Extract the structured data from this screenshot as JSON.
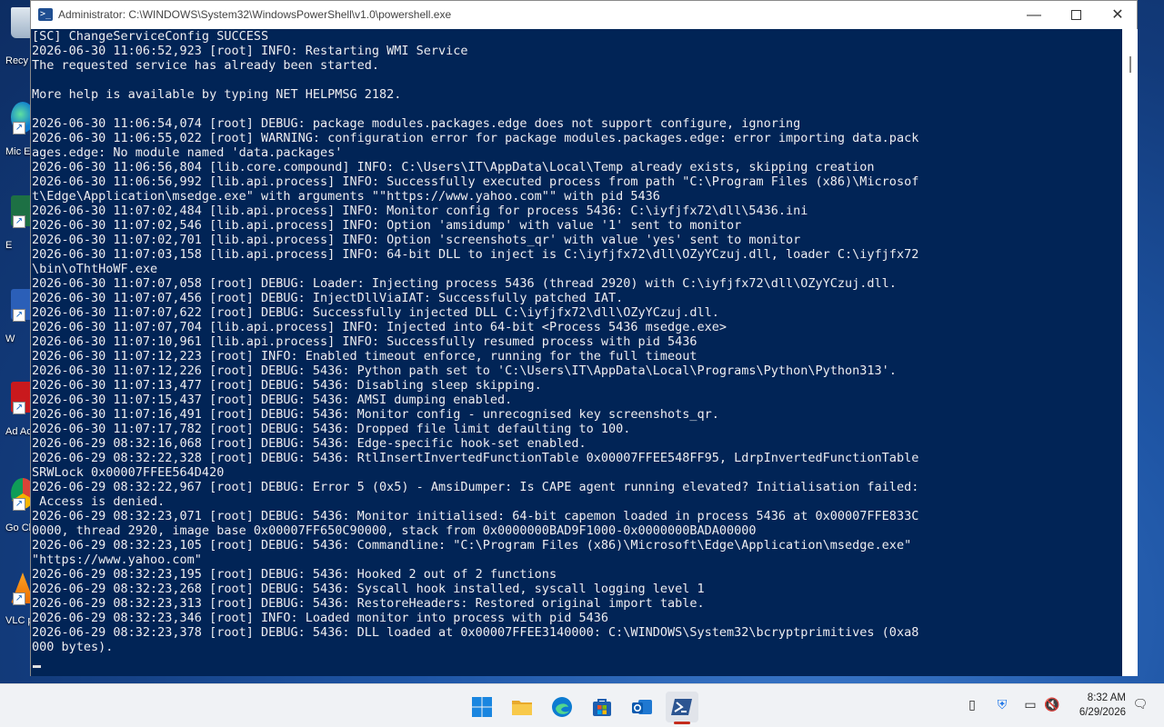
{
  "window": {
    "title": "Administrator: C:\\WINDOWS\\System32\\WindowsPowerShell\\v1.0\\powershell.exe",
    "minimize_icon": "minimize-icon",
    "maximize_icon": "maximize-icon",
    "close_icon": "close-icon"
  },
  "console": {
    "lines": [
      "[SC] ChangeServiceConfig SUCCESS",
      "2026-06-30 11:06:52,923 [root] INFO: Restarting WMI Service",
      "The requested service has already been started.",
      "",
      "More help is available by typing NET HELPMSG 2182.",
      "",
      "2026-06-30 11:06:54,074 [root] DEBUG: package modules.packages.edge does not support configure, ignoring",
      "2026-06-30 11:06:55,022 [root] WARNING: configuration error for package modules.packages.edge: error importing data.pack",
      "ages.edge: No module named 'data.packages'",
      "2026-06-30 11:06:56,804 [lib.core.compound] INFO: C:\\Users\\IT\\AppData\\Local\\Temp already exists, skipping creation",
      "2026-06-30 11:06:56,992 [lib.api.process] INFO: Successfully executed process from path \"C:\\Program Files (x86)\\Microsof",
      "t\\Edge\\Application\\msedge.exe\" with arguments \"\"https://www.yahoo.com\"\" with pid 5436",
      "2026-06-30 11:07:02,484 [lib.api.process] INFO: Monitor config for process 5436: C:\\iyfjfx72\\dll\\5436.ini",
      "2026-06-30 11:07:02,546 [lib.api.process] INFO: Option 'amsidump' with value '1' sent to monitor",
      "2026-06-30 11:07:02,701 [lib.api.process] INFO: Option 'screenshots_qr' with value 'yes' sent to monitor",
      "2026-06-30 11:07:03,158 [lib.api.process] INFO: 64-bit DLL to inject is C:\\iyfjfx72\\dll\\OZyYCzuj.dll, loader C:\\iyfjfx72",
      "\\bin\\oThtHoWF.exe",
      "2026-06-30 11:07:07,058 [root] DEBUG: Loader: Injecting process 5436 (thread 2920) with C:\\iyfjfx72\\dll\\OZyYCzuj.dll.",
      "2026-06-30 11:07:07,456 [root] DEBUG: InjectDllViaIAT: Successfully patched IAT.",
      "2026-06-30 11:07:07,622 [root] DEBUG: Successfully injected DLL C:\\iyfjfx72\\dll\\OZyYCzuj.dll.",
      "2026-06-30 11:07:07,704 [lib.api.process] INFO: Injected into 64-bit <Process 5436 msedge.exe>",
      "2026-06-30 11:07:10,961 [lib.api.process] INFO: Successfully resumed process with pid 5436",
      "2026-06-30 11:07:12,223 [root] INFO: Enabled timeout enforce, running for the full timeout",
      "2026-06-30 11:07:12,226 [root] DEBUG: 5436: Python path set to 'C:\\Users\\IT\\AppData\\Local\\Programs\\Python\\Python313'.",
      "2026-06-30 11:07:13,477 [root] DEBUG: 5436: Disabling sleep skipping.",
      "2026-06-30 11:07:15,437 [root] DEBUG: 5436: AMSI dumping enabled.",
      "2026-06-30 11:07:16,491 [root] DEBUG: 5436: Monitor config - unrecognised key screenshots_qr.",
      "2026-06-30 11:07:17,782 [root] DEBUG: 5436: Dropped file limit defaulting to 100.",
      "2026-06-29 08:32:16,068 [root] DEBUG: 5436: Edge-specific hook-set enabled.",
      "2026-06-29 08:32:22,328 [root] DEBUG: 5436: RtlInsertInvertedFunctionTable 0x00007FFEE548FF95, LdrpInvertedFunctionTable",
      "SRWLock 0x00007FFEE564D420",
      "2026-06-29 08:32:22,967 [root] DEBUG: Error 5 (0x5) - AmsiDumper: Is CAPE agent running elevated? Initialisation failed:",
      " Access is denied.",
      "2026-06-29 08:32:23,071 [root] DEBUG: 5436: Monitor initialised: 64-bit capemon loaded in process 5436 at 0x00007FFE833C",
      "0000, thread 2920, image base 0x00007FF650C90000, stack from 0x0000000BAD9F1000-0x0000000BADA00000",
      "2026-06-29 08:32:23,105 [root] DEBUG: 5436: Commandline: \"C:\\Program Files (x86)\\Microsoft\\Edge\\Application\\msedge.exe\"",
      "\"https://www.yahoo.com\"",
      "2026-06-29 08:32:23,195 [root] DEBUG: 5436: Hooked 2 out of 2 functions",
      "2026-06-29 08:32:23,268 [root] DEBUG: 5436: Syscall hook installed, syscall logging level 1",
      "2026-06-29 08:32:23,313 [root] DEBUG: 5436: RestoreHeaders: Restored original import table.",
      "2026-06-29 08:32:23,346 [root] INFO: Loaded monitor into process with pid 5436",
      "2026-06-29 08:32:23,378 [root] DEBUG: 5436: DLL loaded at 0x00007FFEE3140000: C:\\WINDOWS\\System32\\bcryptprimitives (0xa8",
      "000 bytes)."
    ],
    "background": "#012456",
    "foreground": "#EEEDF0"
  },
  "desktop": {
    "icons": [
      {
        "label": "Recy",
        "icon": "recycle-bin-icon"
      },
      {
        "label": "Mic Ed",
        "icon": "edge-icon"
      },
      {
        "label": "E",
        "icon": "excel-icon"
      },
      {
        "label": "W",
        "icon": "word-icon"
      },
      {
        "label": "Ad Acr",
        "icon": "acrobat-icon"
      },
      {
        "label": "Go Chr",
        "icon": "chrome-icon"
      },
      {
        "label": "VLC pl",
        "icon": "vlc-icon"
      }
    ]
  },
  "taskbar": {
    "items": [
      {
        "name": "start",
        "icon": "windows-start-icon"
      },
      {
        "name": "file-explorer",
        "icon": "folder-icon"
      },
      {
        "name": "edge",
        "icon": "edge-icon"
      },
      {
        "name": "store",
        "icon": "store-icon"
      },
      {
        "name": "outlook",
        "icon": "outlook-icon"
      },
      {
        "name": "powershell",
        "icon": "powershell-icon",
        "active": true
      }
    ],
    "tray": [
      "usb-icon",
      "security-icon",
      "network-icon",
      "volume-muted-icon"
    ],
    "time": "8:32 AM",
    "date": "6/29/2026",
    "notification_icon": "notification-icon"
  }
}
